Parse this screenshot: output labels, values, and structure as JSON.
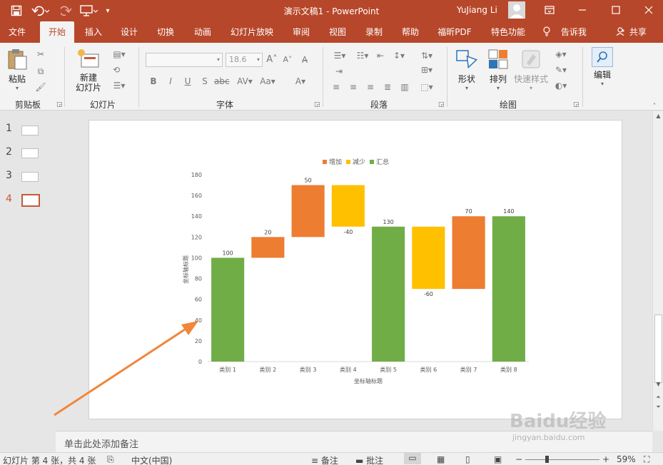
{
  "app": {
    "title": "演示文稿1  -  PowerPoint",
    "user": "YuJiang Li",
    "accent": "#b7472a"
  },
  "tabs": [
    "文件",
    "开始",
    "插入",
    "设计",
    "切换",
    "动画",
    "幻灯片放映",
    "审阅",
    "视图",
    "录制",
    "帮助",
    "福昕PDF",
    "特色功能"
  ],
  "active_tab": "开始",
  "tell_me": "告诉我",
  "share": "共享",
  "ribbon": {
    "paste": "粘贴",
    "clipboard": "剪贴板",
    "new_slide_line1": "新建",
    "new_slide_line2": "幻灯片",
    "slides": "幻灯片",
    "font_size": "18.6",
    "font": "字体",
    "paragraph": "段落",
    "shapes": "形状",
    "arrange": "排列",
    "quick_styles": "快速样式",
    "drawing": "绘图",
    "edit": "编辑"
  },
  "thumbnails": [
    {
      "num": "1",
      "selected": false
    },
    {
      "num": "2",
      "selected": false
    },
    {
      "num": "3",
      "selected": false
    },
    {
      "num": "4",
      "selected": true
    }
  ],
  "notes_placeholder": "单击此处添加备注",
  "status": {
    "slide_info": "幻灯片 第 4 张，共 4 张",
    "language": "中文(中国)",
    "notes": "备注",
    "comments": "批注",
    "zoom": "59%"
  },
  "watermark": {
    "text": "Baidu经验",
    "url": "jingyan.baidu.com"
  },
  "chart_data": {
    "type": "waterfall",
    "categories": [
      "类别 1",
      "类别 2",
      "类别 3",
      "类别 4",
      "类别 5",
      "类别 6",
      "类别 7",
      "类别 8"
    ],
    "values": [
      100,
      20,
      50,
      -40,
      130,
      -60,
      70,
      140
    ],
    "kinds": [
      "total",
      "increase",
      "increase",
      "decrease",
      "total",
      "decrease",
      "increase",
      "total"
    ],
    "labels": [
      "100",
      "20",
      "50",
      "-40",
      "130",
      "-60",
      "70",
      "140"
    ],
    "legend": [
      {
        "name": "增加",
        "color": "#ed7d31"
      },
      {
        "name": "减少",
        "color": "#ffc000"
      },
      {
        "name": "汇总",
        "color": "#70ad47"
      }
    ],
    "xlabel": "坐标轴标题",
    "ylabel": "坐标轴标题",
    "ylim": [
      0,
      180
    ],
    "yticks": [
      "0",
      "20",
      "40",
      "60",
      "80",
      "100",
      "120",
      "140",
      "160",
      "180"
    ],
    "legend_position": "top",
    "grid": false
  }
}
